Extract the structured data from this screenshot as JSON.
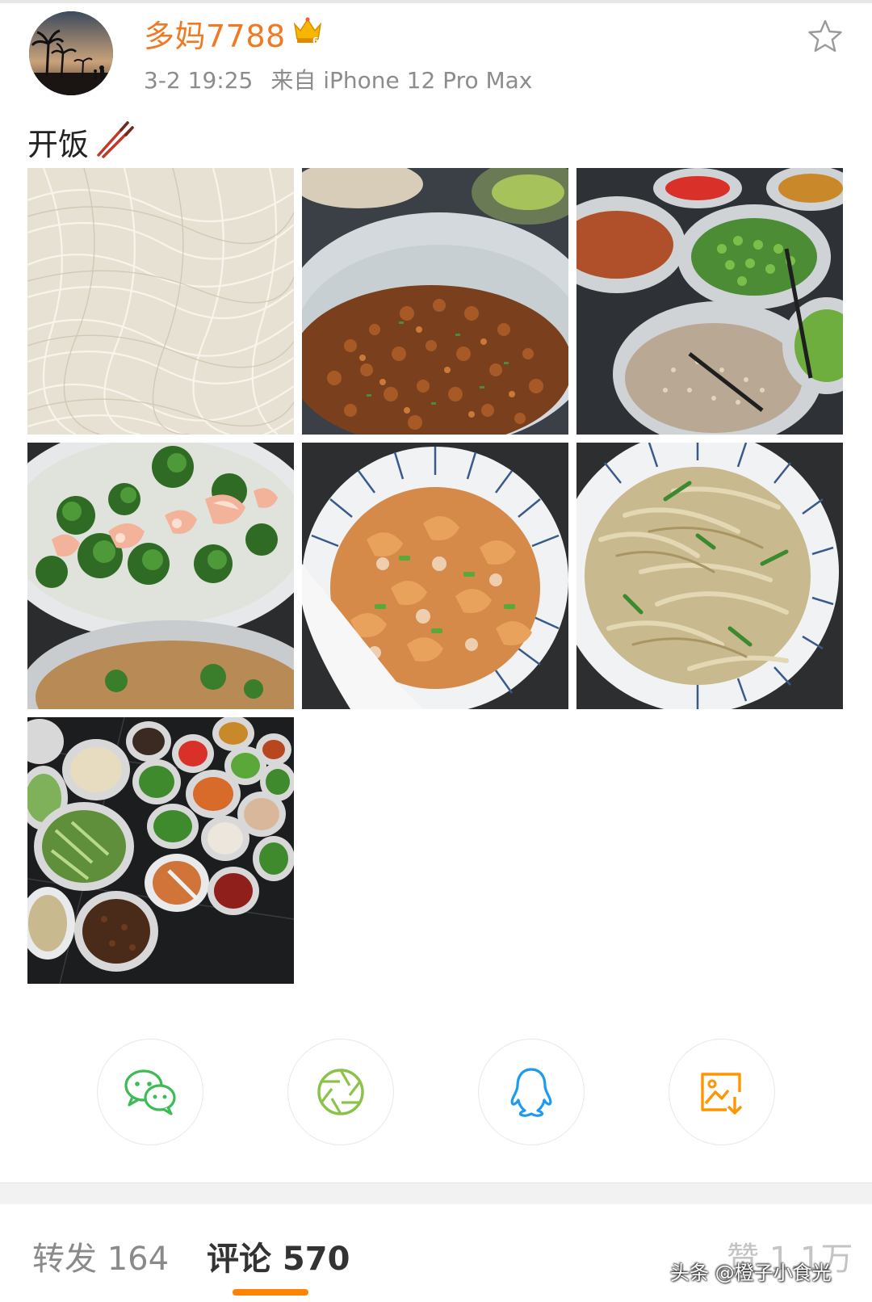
{
  "post": {
    "username": "多妈7788",
    "vip_icon": "crown-icon",
    "date": "3-2 19:25",
    "source": "来自 iPhone 12 Pro Max",
    "text": "开饭",
    "text_emoji": "chopsticks-icon"
  },
  "photos": [
    {
      "name": "photo-noodles",
      "subject": "plain noodles"
    },
    {
      "name": "photo-minced-meat",
      "subject": "fried minced meat"
    },
    {
      "name": "photo-condiment-bowls",
      "subject": "sauce, peas, sesame bowls"
    },
    {
      "name": "photo-shrimp-broccoli",
      "subject": "shrimp with broccoli"
    },
    {
      "name": "photo-dried-shrimp",
      "subject": "dried shrimp with scallion"
    },
    {
      "name": "photo-bamboo-shoots",
      "subject": "shredded bamboo shoots"
    },
    {
      "name": "photo-table-spread",
      "subject": "table of many small dishes"
    }
  ],
  "share": {
    "wechat_icon": "wechat-icon",
    "moments_icon": "moments-icon",
    "qq_icon": "qq-icon",
    "save_icon": "save-image-icon"
  },
  "tabs": {
    "repost": "转发 164",
    "comment": "评论 570",
    "like": "赞 1.1万"
  },
  "watermark": "头条 @橙子小食光",
  "colors": {
    "username": "#f07a24",
    "accent": "#ff8200",
    "meta": "#8c8c8c"
  }
}
